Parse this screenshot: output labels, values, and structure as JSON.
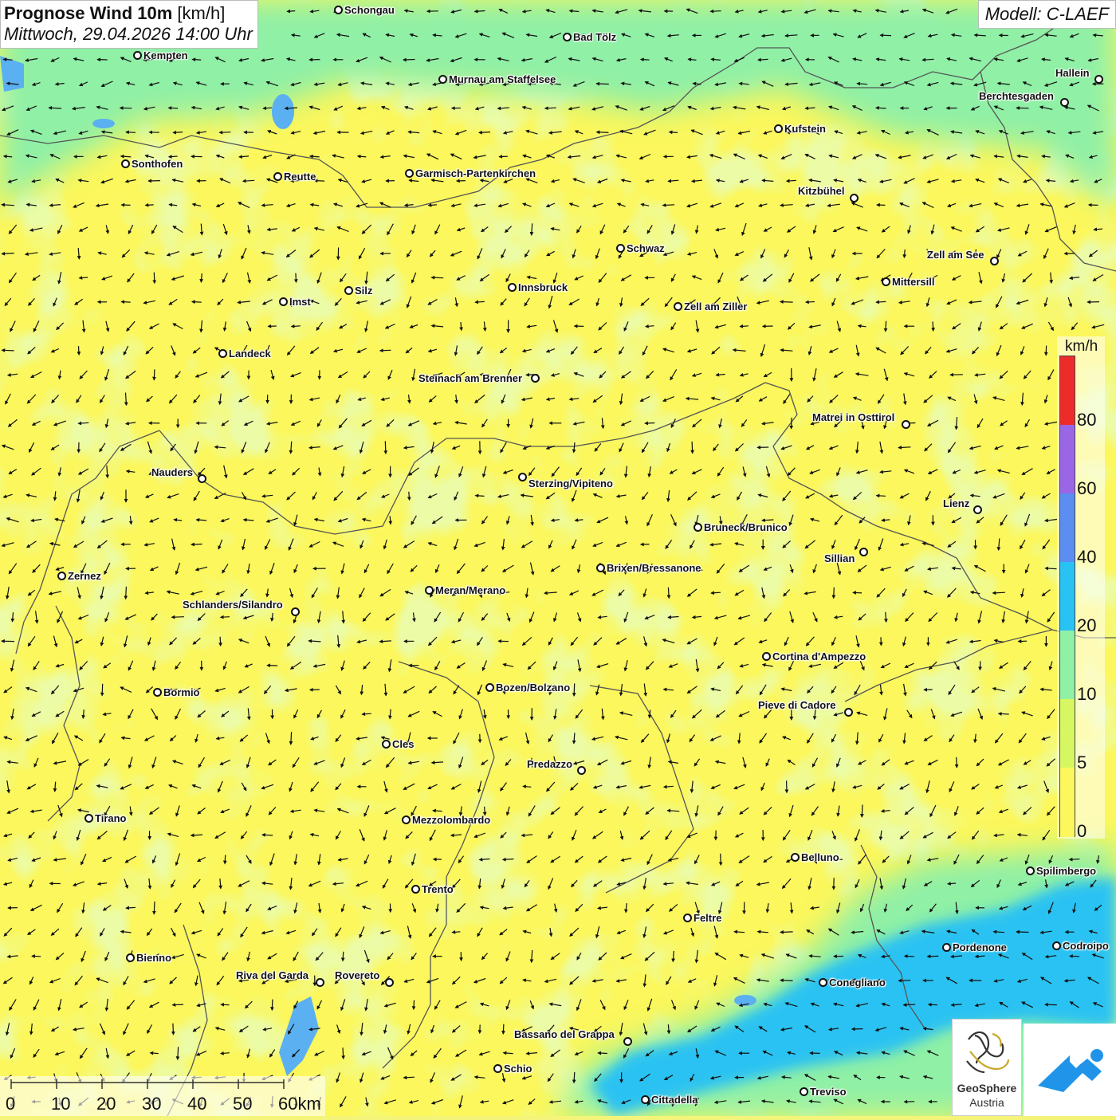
{
  "title": {
    "product": "Prognose Wind 10m",
    "unit": "[km/h]",
    "datetime": "Mittwoch, 29.04.2026 14:00 Uhr"
  },
  "model_label": "Modell: C-LAEF",
  "legend": {
    "unit": "km/h",
    "labels": [
      "80",
      "60",
      "40",
      "20",
      "10",
      "5",
      "0"
    ],
    "colors": [
      "#ee2b2b",
      "#9a66e6",
      "#5b8ef0",
      "#29c2f2",
      "#8ff0a6",
      "#d6f762",
      "#fbf75c"
    ]
  },
  "scale_bar": {
    "labels": [
      "0",
      "10",
      "20",
      "30",
      "40",
      "50",
      "60km"
    ]
  },
  "cities": [
    "Schongau",
    "Kempten",
    "Bad Tölz",
    "Murnau am Staffelsee",
    "Hallein",
    "Berchtesgaden",
    "Kufstein",
    "Sonthofen",
    "Reutte",
    "Garmisch-Partenkirchen",
    "Kitzbühel",
    "Schwaz",
    "Zell am See",
    "Mittersill",
    "Innsbruck",
    "Imst",
    "Silz",
    "Zell am Ziller",
    "Landeck",
    "Steinach am Brenner",
    "Matrei in Osttirol",
    "Nauders",
    "Sterzing/Vipiteno",
    "Lienz",
    "Bruneck/Brunico",
    "Sillian",
    "Brixen/Bressanone",
    "Zernez",
    "Meran/Merano",
    "Schlanders/Silandro",
    "Cortina d'Ampezzo",
    "Bozen/Bolzano",
    "Bormio",
    "Pieve di Cadore",
    "Cles",
    "Predazzo",
    "Tirano",
    "Mezzolombardo",
    "Belluno",
    "Spilimbergo",
    "Trento",
    "Feltre",
    "Pordenone",
    "Codroipo",
    "Bienno",
    "Riva del Garda",
    "Rovereto",
    "Conegliano",
    "Bassano del Grappa",
    "Schio",
    "Treviso",
    "Cittadella"
  ],
  "logo": {
    "name": "GeoSphere",
    "sub": "Austria"
  },
  "colors": {
    "calm": "#fbf75c",
    "light": "#d6f762",
    "moderate": "#8ff0a6",
    "fresh": "#29c2f2",
    "lake": "#5ab0f0",
    "border": "#555555",
    "arrow": "#111111"
  }
}
